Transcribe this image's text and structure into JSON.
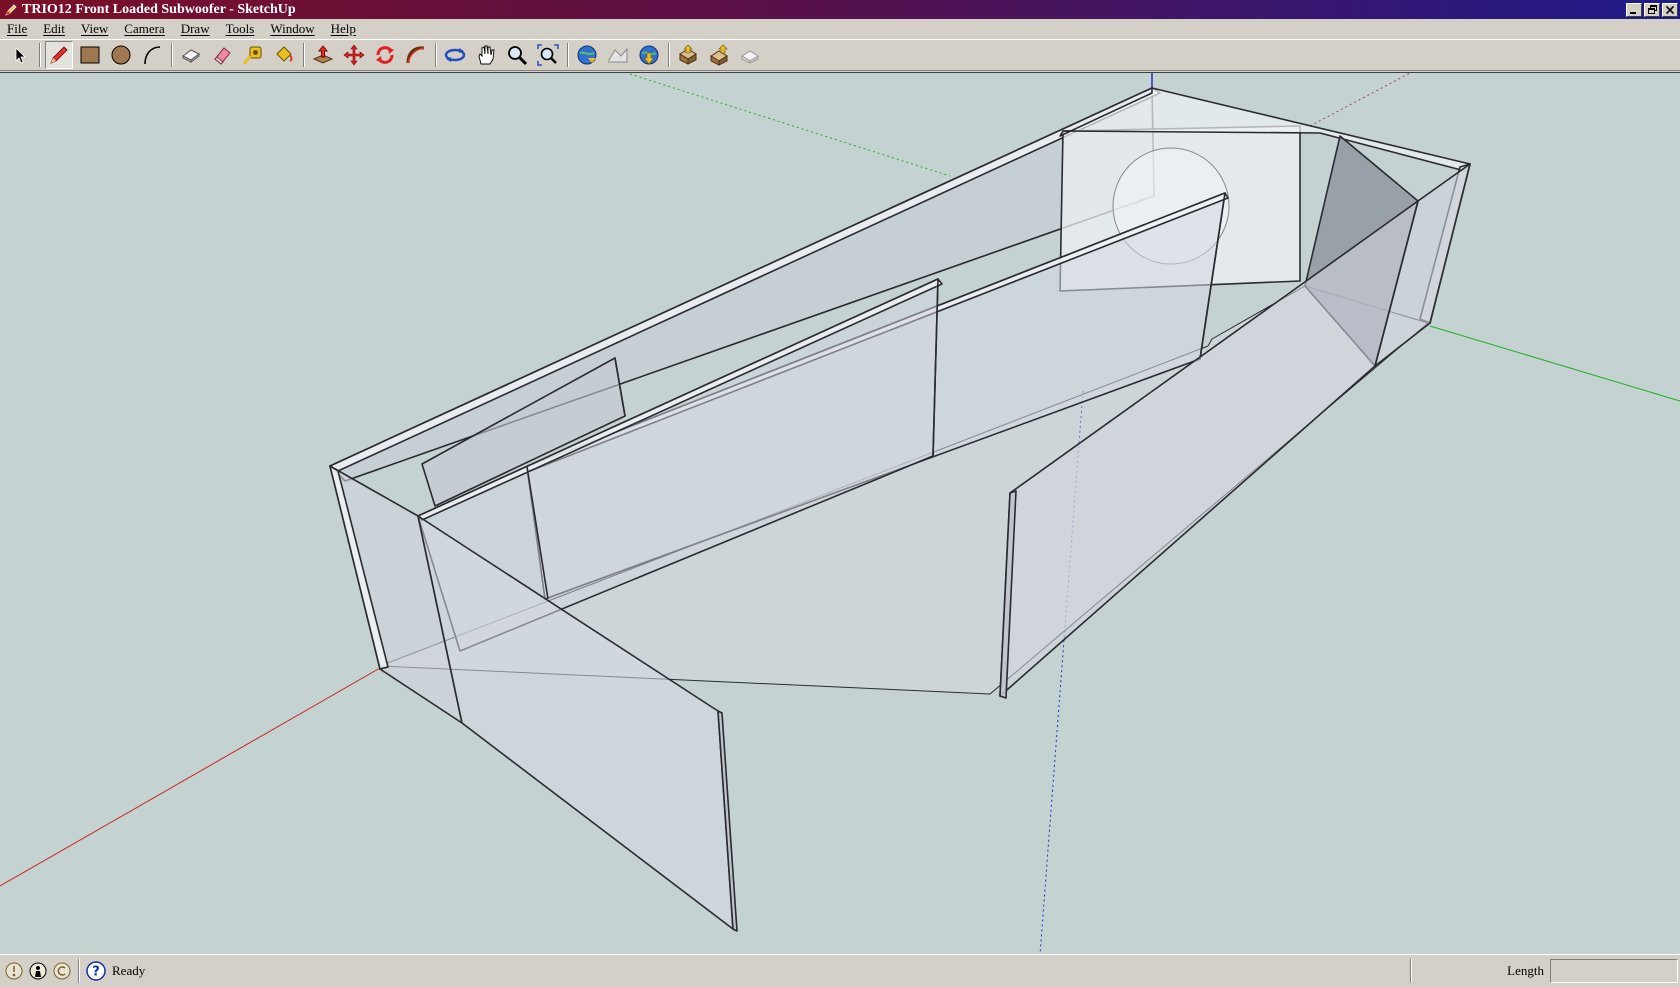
{
  "window": {
    "title": "TRIO12 Front Loaded Subwoofer - SketchUp",
    "icon": "sketchup-pencil-icon"
  },
  "menubar": {
    "items": [
      "File",
      "Edit",
      "View",
      "Camera",
      "Draw",
      "Tools",
      "Window",
      "Help"
    ]
  },
  "toolbar": {
    "tools": [
      "select-icon",
      "pencil-line-icon",
      "rectangle-icon",
      "circle-icon",
      "arc-icon",
      "make-component-icon",
      "eraser-icon",
      "tape-measure-icon",
      "paint-bucket-icon",
      "push-pull-icon",
      "move-icon",
      "rotate-icon",
      "follow-me-icon",
      "orbit-icon",
      "pan-icon",
      "zoom-icon",
      "zoom-extents-icon",
      "get-current-view-icon",
      "toggle-terrain-icon",
      "place-model-icon",
      "get-models-icon",
      "share-model-icon",
      "share-component-icon"
    ],
    "active_tool": "pencil-line-icon"
  },
  "viewport": {
    "background": "#c4d2d2",
    "axis_colors": {
      "red": "#cc2020",
      "green": "#20b020",
      "blue": "#2030c0"
    }
  },
  "statusbar": {
    "status_text": "Ready",
    "vcb_label": "Length",
    "vcb_value": "",
    "icons": [
      "geo-location-icon",
      "credits-icon",
      "user-icon",
      "help-icon"
    ]
  }
}
